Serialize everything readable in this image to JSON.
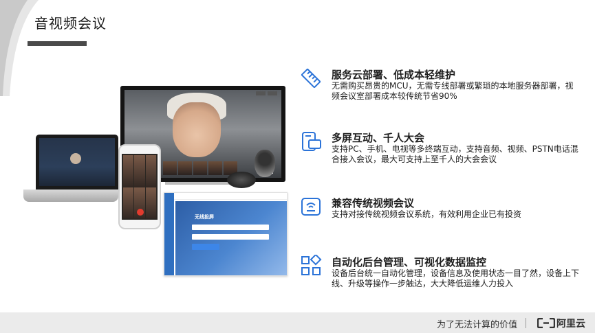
{
  "slide": {
    "title": "音视频会议"
  },
  "features": [
    {
      "icon": "ruler-icon",
      "title": "服务云部署、低成本轻维护",
      "desc": "无需购买昂贵的MCU，无需专线部署或繁琐的本地服务器部署，视频会议室部署成本较传统节省90%"
    },
    {
      "icon": "multi-screen-icon",
      "title": "多屏互动、千人大会",
      "desc": "支持PC、手机、电视等多终端互动，支持音频、视频、PSTN电话混合接入会议，最大可支持上至千人的大会会议"
    },
    {
      "icon": "projector-icon",
      "title": "兼容传统视频会议",
      "desc": "支持对接传统视频会议系统，有效利用企业已有投资"
    },
    {
      "icon": "grid-apps-icon",
      "title": "自动化后台管理、可视化数据监控",
      "desc": "设备后台统一自动化管理，设备信息及使用状态一目了然，设备上下线、升级等操作一步触达，大大降低运维人力投入"
    }
  ],
  "illustration": {
    "monitor_logo": "无线投屏"
  },
  "footer": {
    "slogan": "为了无法计算的价值",
    "logo_text": "阿里云"
  },
  "colors": {
    "accent": "#2b73d8",
    "footer_bg": "#ebebeb"
  }
}
